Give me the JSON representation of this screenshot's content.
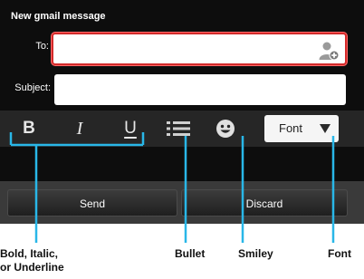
{
  "dialog": {
    "title": "New gmail message"
  },
  "to": {
    "label": "To:",
    "value": "",
    "contact_icon": "add-contact-icon"
  },
  "subject": {
    "label": "Subject:",
    "value": ""
  },
  "toolbar": {
    "bold_label": "B",
    "italic_label": "I",
    "underline_label": "U",
    "bullet_icon": "bulleted-list-icon",
    "smiley_icon": "smiley-icon",
    "font_label": "Font"
  },
  "buttons": {
    "send": "Send",
    "discard": "Discard"
  },
  "callouts": {
    "bold_line1": "Bold, Italic,",
    "bold_line2": "or Underline",
    "bullet": "Bullet",
    "smiley": "Smiley",
    "font": "Font"
  },
  "colors": {
    "focus_border": "#d42a2a",
    "callout_line": "#29b7e8",
    "background": "#0d0d0d"
  }
}
